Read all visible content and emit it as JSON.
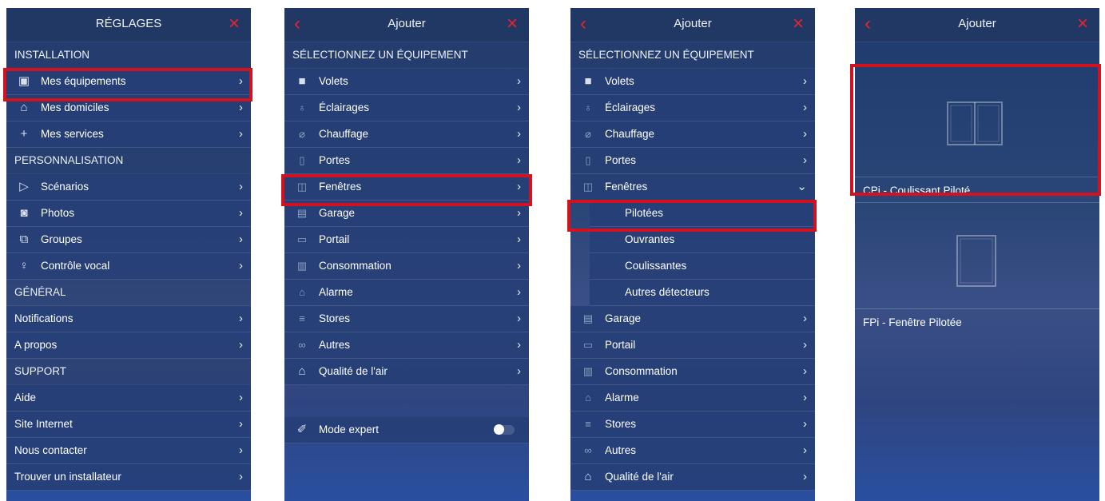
{
  "panel1": {
    "title": "RÉGLAGES",
    "close_icon": "×",
    "sections": {
      "installation": "INSTALLATION",
      "personnalisation": "PERSONNALISATION",
      "general": "GÉNÉRAL",
      "support": "SUPPORT"
    },
    "items": {
      "equipements": "Mes équipements",
      "domiciles": "Mes domiciles",
      "services": "Mes services",
      "scenarios": "Scénarios",
      "photos": "Photos",
      "groupes": "Groupes",
      "controle_vocal": "Contrôle vocal",
      "notifications": "Notifications",
      "a_propos": "A propos",
      "aide": "Aide",
      "site_internet": "Site Internet",
      "nous_contacter": "Nous contacter",
      "trouver_installateur": "Trouver un installateur"
    }
  },
  "panel2": {
    "title": "Ajouter",
    "section": "SÉLECTIONNEZ UN ÉQUIPEMENT",
    "items": [
      "Volets",
      "Éclairages",
      "Chauffage",
      "Portes",
      "Fenêtres",
      "Garage",
      "Portail",
      "Consommation",
      "Alarme",
      "Stores",
      "Autres",
      "Qualité de l'air"
    ],
    "mode_expert": "Mode expert",
    "mode_expert_on": false
  },
  "panel3": {
    "title": "Ajouter",
    "section": "SÉLECTIONNEZ UN ÉQUIPEMENT",
    "items_before": [
      "Volets",
      "Éclairages",
      "Chauffage",
      "Portes",
      "Fenêtres"
    ],
    "subitems": [
      "Pilotées",
      "Ouvrantes",
      "Coulissantes",
      "Autres détecteurs"
    ],
    "items_after": [
      "Garage",
      "Portail",
      "Consommation",
      "Alarme",
      "Stores",
      "Autres",
      "Qualité de l'air"
    ]
  },
  "panel4": {
    "title": "Ajouter",
    "cards": [
      "CPi - Coulissant Piloté",
      "FPi - Fenêtre Pilotée"
    ]
  },
  "colors": {
    "accent_red": "#e8232e",
    "highlight_red": "#d4121f",
    "panel_blue": "#26407a"
  },
  "glyphs": {
    "back": "‹",
    "close": "×",
    "chevron": "›",
    "chevron_down": "⌄"
  }
}
